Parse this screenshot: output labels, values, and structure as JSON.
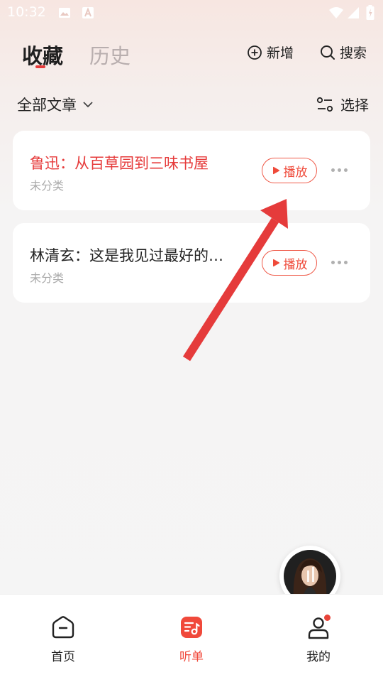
{
  "status_bar": {
    "time": "10:32"
  },
  "header": {
    "tabs": [
      {
        "label": "收藏",
        "active": true
      },
      {
        "label": "历史",
        "active": false
      }
    ],
    "add_label": "新增",
    "search_label": "搜索"
  },
  "filter": {
    "all_articles_label": "全部文章",
    "select_label": "选择"
  },
  "items": [
    {
      "title": "鲁迅：从百草园到三味书屋",
      "category": "未分类",
      "play_label": "播放",
      "highlighted": true
    },
    {
      "title": "林清玄：这是我见过最好的…",
      "category": "未分类",
      "play_label": "播放",
      "highlighted": false
    }
  ],
  "nav": [
    {
      "label": "首页",
      "icon": "home-icon",
      "active": false
    },
    {
      "label": "听单",
      "icon": "playlist-icon",
      "active": true
    },
    {
      "label": "我的",
      "icon": "profile-icon",
      "active": false,
      "badge": true
    }
  ],
  "colors": {
    "accent": "#e63b3b",
    "play_border": "#ef5b4a",
    "nav_active": "#f0493b",
    "annotation_arrow": "#e53b3b"
  }
}
